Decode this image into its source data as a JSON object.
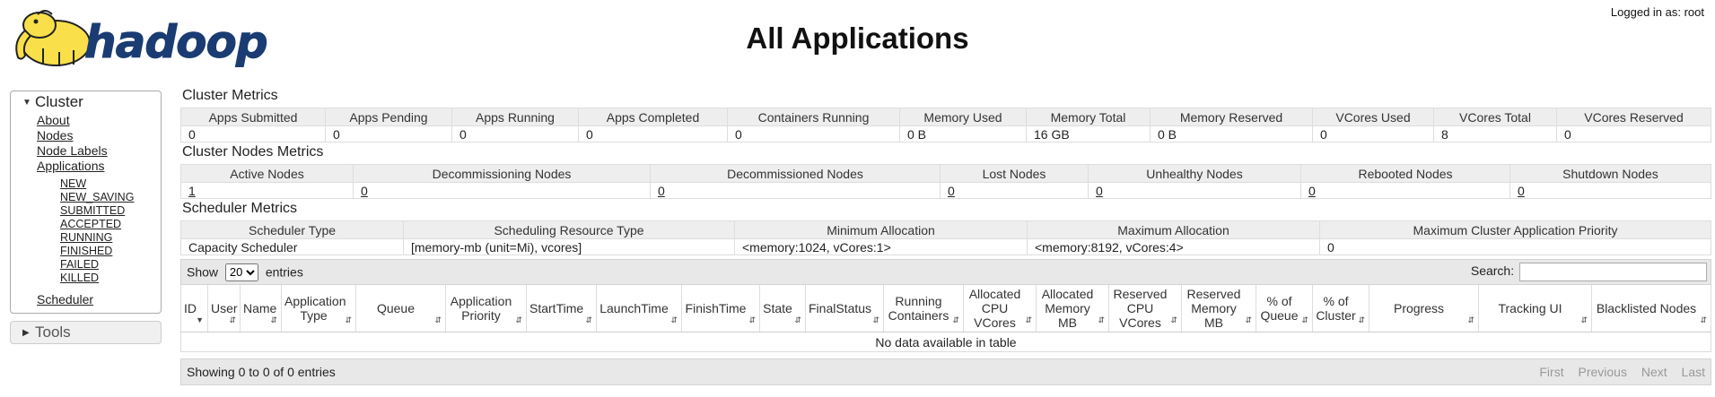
{
  "header": {
    "logo_text": "hadoop",
    "title": "All Applications",
    "login_status": "Logged in as: root"
  },
  "navigation": {
    "cluster_label": "Cluster",
    "links": [
      "About",
      "Nodes",
      "Node Labels",
      "Applications"
    ],
    "app_states": [
      "NEW",
      "NEW_SAVING",
      "SUBMITTED",
      "ACCEPTED",
      "RUNNING",
      "FINISHED",
      "FAILED",
      "KILLED"
    ],
    "scheduler": "Scheduler",
    "tools_label": "Tools"
  },
  "cluster_metrics": {
    "title": "Cluster Metrics",
    "headers": [
      "Apps Submitted",
      "Apps Pending",
      "Apps Running",
      "Apps Completed",
      "Containers Running",
      "Memory Used",
      "Memory Total",
      "Memory Reserved",
      "VCores Used",
      "VCores Total",
      "VCores Reserved"
    ],
    "values": [
      "0",
      "0",
      "0",
      "0",
      "0",
      "0 B",
      "16 GB",
      "0 B",
      "0",
      "8",
      "0"
    ]
  },
  "cluster_nodes_metrics": {
    "title": "Cluster Nodes Metrics",
    "headers": [
      "Active Nodes",
      "Decommissioning Nodes",
      "Decommissioned Nodes",
      "Lost Nodes",
      "Unhealthy Nodes",
      "Rebooted Nodes",
      "Shutdown Nodes"
    ],
    "values": [
      "1",
      "0",
      "0",
      "0",
      "0",
      "0",
      "0"
    ]
  },
  "scheduler_metrics": {
    "title": "Scheduler Metrics",
    "headers": [
      "Scheduler Type",
      "Scheduling Resource Type",
      "Minimum Allocation",
      "Maximum Allocation",
      "Maximum Cluster Application Priority"
    ],
    "values": [
      "Capacity Scheduler",
      "[memory-mb (unit=Mi), vcores]",
      "<memory:1024, vCores:1>",
      "<memory:8192, vCores:4>",
      "0"
    ]
  },
  "apps_table": {
    "show_label": "Show",
    "entries_label": "entries",
    "page_size": "20",
    "search_label": "Search:",
    "columns": [
      "ID",
      "User",
      "Name",
      "Application Type",
      "Queue",
      "Application Priority",
      "StartTime",
      "LaunchTime",
      "FinishTime",
      "State",
      "FinalStatus",
      "Running Containers",
      "Allocated CPU VCores",
      "Allocated Memory MB",
      "Reserved CPU VCores",
      "Reserved Memory MB",
      "% of Queue",
      "% of Cluster",
      "Progress",
      "Tracking UI",
      "Blacklisted Nodes"
    ],
    "empty_message": "No data available in table",
    "info": "Showing 0 to 0 of 0 entries",
    "pagination": [
      "First",
      "Previous",
      "Next",
      "Last"
    ]
  }
}
